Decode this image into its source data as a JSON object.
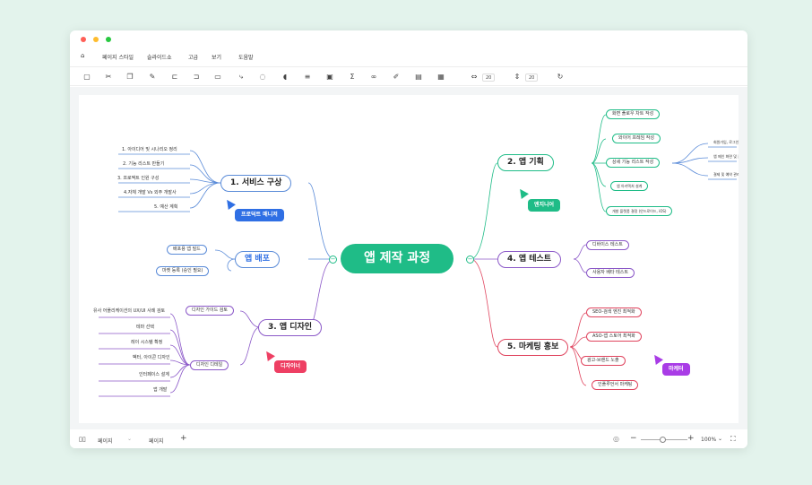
{
  "menu": {
    "home_icon": "home-icon",
    "items": [
      "페이지 스타일",
      "슬라이드쇼",
      "고급",
      "보기",
      "도움말"
    ]
  },
  "toolbar": {
    "spacing_h": "20",
    "spacing_v": "20"
  },
  "mindmap": {
    "root": "앱 제작 과정",
    "branches": {
      "service": "1. 서비스 구상",
      "planning": "2. 앱 기획",
      "design": "3. 앱 디자인",
      "test": "4. 앱 테스트",
      "marketing": "5. 마케팅 홍보",
      "deploy": "앱 배포"
    },
    "service_items": [
      "1. 아이디어 및 시나리오 정리",
      "2. 기능 리스트 만들기",
      "3. 프로젝트 인원 구성",
      "4.자체 개발 Vs 외주 개발사",
      "5. 예산 계획"
    ],
    "planning_items": [
      "화면 플로우 차트 작성",
      "와이어 프레임 작성",
      "상세 기능 리스트 작성",
      "앱 아키텍처 설계",
      "개발 플랫폼 결정 (안드로이드, iOS)"
    ],
    "planning_sub": [
      "회원가입, 로그인, 프로필 ...",
      "앱 메인 화면 및 콘텐츠 구성 ...",
      "결제 및 예약 관리 ..."
    ],
    "deploy_items": [
      "배포용 앱 빌드",
      "마켓 등록 (승인 필요)"
    ],
    "design_items": [
      "디자인 가이드 검토",
      "디자인 디테일"
    ],
    "design_sub": [
      "유사 어플리케이션의 UX/UI 사례 검토",
      "테마 선택",
      "레이 시스템 확정",
      "벡터, 아이콘 디자인",
      "인터페이스 설계",
      "앱 개발"
    ],
    "test_items": [
      "디바이스 테스트",
      "사용자 베타 테스트"
    ],
    "marketing_items": [
      "SEO-검색 엔진 최적화",
      "ASO-앱 스토어 최적화",
      "광고-브랜드 노출",
      "인플루언서 마케팅"
    ],
    "tags": {
      "pm": "프로덕트 매니저",
      "engineer": "엔지니어",
      "designer": "디자이너",
      "marketer": "마케터"
    }
  },
  "statusbar": {
    "page_label": "페이지",
    "page_tab": "페이지",
    "add": "+",
    "zoom": "100%"
  },
  "colors": {
    "root": "#1fbc87",
    "service": "#5a8bd8",
    "planning": "#1fbc87",
    "design": "#8b58c8",
    "test": "#8b58c8",
    "marketing": "#e0445e",
    "tag_pm": "#2f6fe4",
    "tag_engineer": "#1fbc87",
    "tag_designer": "#ee3f63",
    "tag_marketer": "#a93ce6"
  }
}
